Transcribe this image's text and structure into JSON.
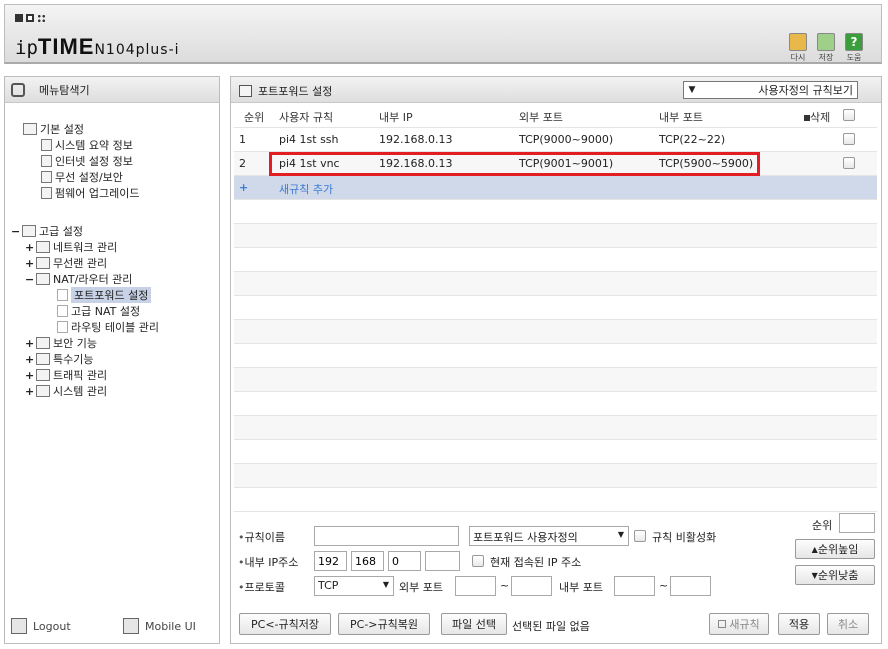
{
  "header": {
    "logo_ip": "ip",
    "logo_time": "TIME",
    "logo_model": "N104plus-i",
    "buttons": [
      {
        "label": "다시",
        "icon": "reload-icon"
      },
      {
        "label": "저장",
        "icon": "save-icon"
      },
      {
        "label": "도움",
        "icon": "help-icon"
      }
    ]
  },
  "sidebar": {
    "title": "메뉴탐색기",
    "basic": {
      "label": "기본 설정",
      "items": [
        "시스템 요약 정보",
        "인터넷 설정 정보",
        "무선 설정/보안",
        "펌웨어 업그레이드"
      ]
    },
    "advanced": {
      "label": "고급 설정",
      "items": [
        {
          "label": "네트워크 관리",
          "exp": "+"
        },
        {
          "label": "무선랜 관리",
          "exp": "+"
        },
        {
          "label": "NAT/라우터 관리",
          "exp": "−"
        },
        {
          "label": "보안 기능",
          "exp": "+"
        },
        {
          "label": "특수기능",
          "exp": "+"
        },
        {
          "label": "트래픽 관리",
          "exp": "+"
        },
        {
          "label": "시스템 관리",
          "exp": "+"
        }
      ],
      "nat_items": [
        "포트포워드 설정",
        "고급 NAT 설정",
        "라우팅 테이블 관리"
      ],
      "selected": "포트포워드 설정"
    },
    "footer": {
      "logout": "Logout",
      "mobile": "Mobile UI"
    }
  },
  "main": {
    "title": "포트포워드 설정",
    "view_select": "사용자정의 규칙보기",
    "columns": {
      "seq": "순위",
      "rule": "사용자 규칙",
      "ip": "내부 IP",
      "ext": "외부 포트",
      "int": "내부 포트",
      "del": "삭제"
    },
    "rows": [
      {
        "seq": "1",
        "rule": "pi4 1st ssh",
        "ip": "192.168.0.13",
        "ext": "TCP(9000~9000)",
        "int": "TCP(22~22)"
      },
      {
        "seq": "2",
        "rule": "pi4 1st vnc",
        "ip": "192.168.0.13",
        "ext": "TCP(9001~9001)",
        "int": "TCP(5900~5900)"
      }
    ],
    "add_row": {
      "plus": "+",
      "label": "새규칙 추가"
    },
    "highlight_color": "#e41d25"
  },
  "form": {
    "rule_name_label": "규칙이름",
    "rule_name_value": "",
    "rule_type": "포트포워드 사용자정의",
    "disable_label": "규칙 비활성화",
    "ip_label": "내부 IP주소",
    "ip_octets": [
      "192",
      "168",
      "0",
      ""
    ],
    "current_ip_label": "현재 접속된 IP 주소",
    "protocol_label": "프로토콜",
    "protocol_value": "TCP",
    "ext_port_label": "외부 포트",
    "int_port_label": "내부 포트",
    "tilde": "~",
    "order_label": "순위",
    "order_value": "",
    "up_label": "순위높임",
    "down_label": "순위낮춤",
    "buttons": {
      "backup": "PC<-규칙저장",
      "restore": "PC->규칙복원",
      "file": "파일 선택",
      "no_file": "선택된 파일 없음",
      "new_rule": "새규칙",
      "apply": "적용",
      "cancel": "취소"
    }
  }
}
